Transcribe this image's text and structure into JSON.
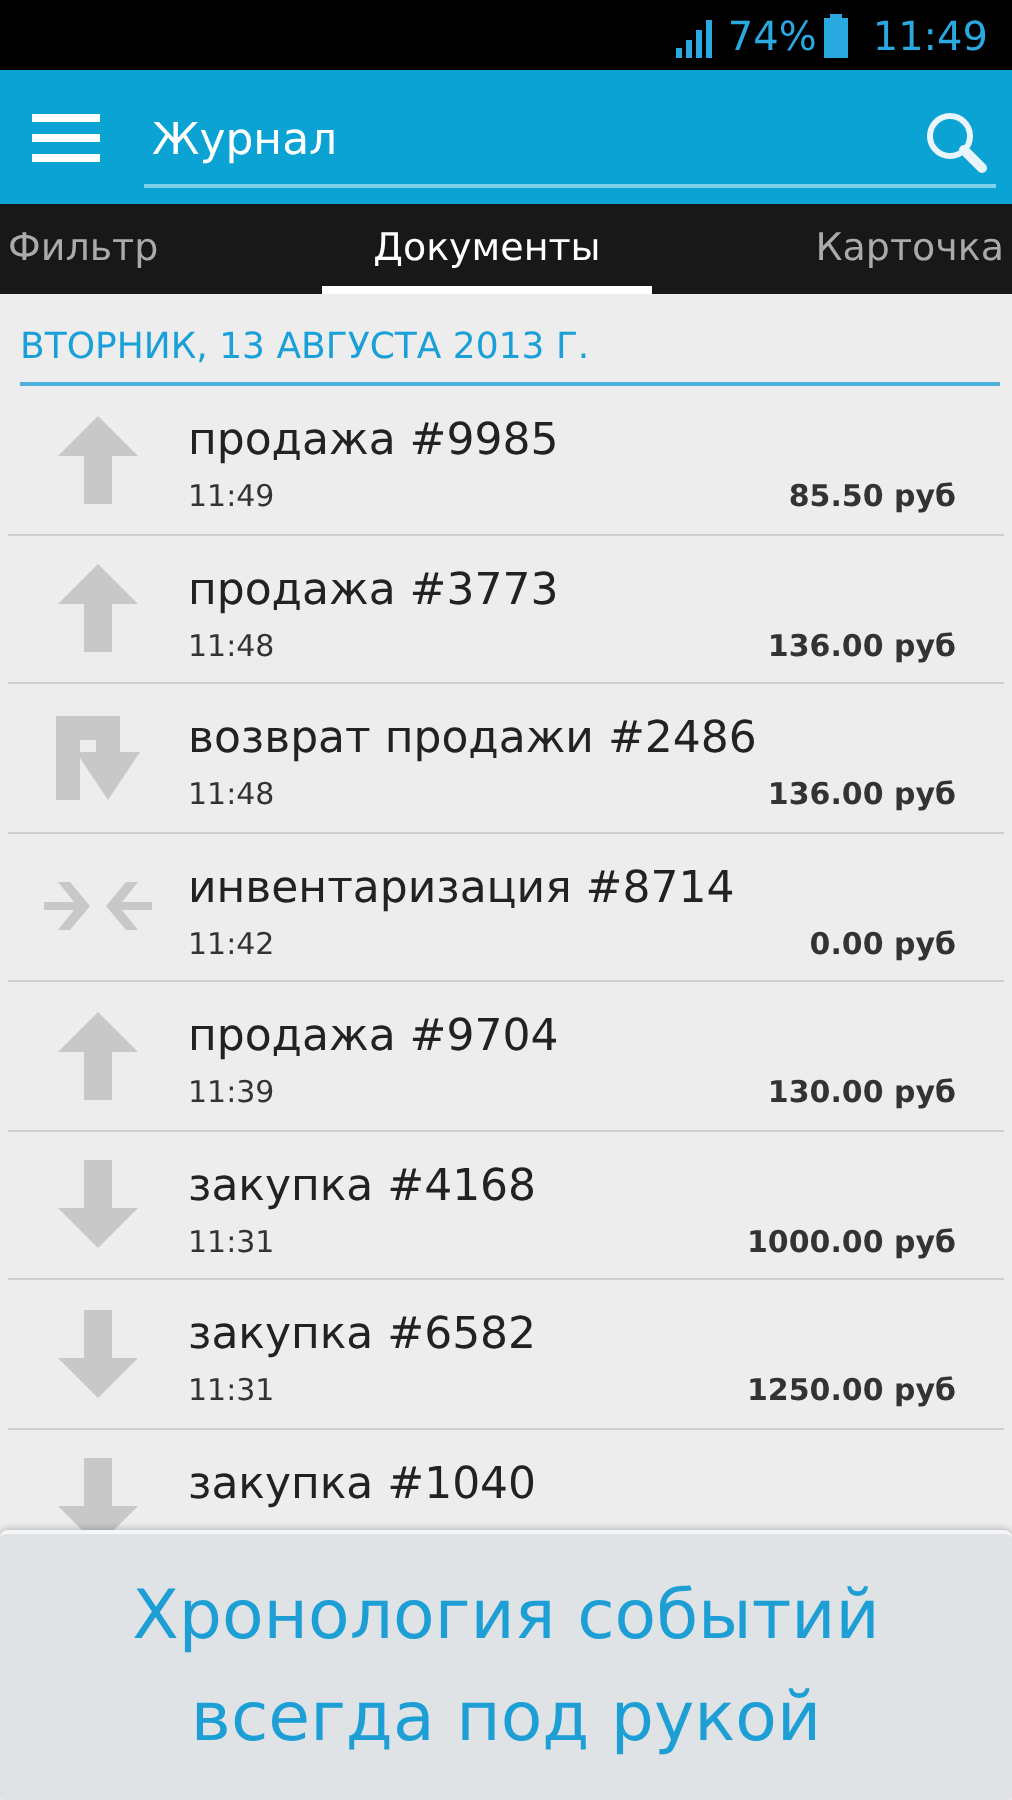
{
  "status_bar": {
    "battery_text": "74%",
    "time": "11:49"
  },
  "action_bar": {
    "title": "Журнал"
  },
  "tabs": [
    {
      "label": "Фильтр",
      "selected": false
    },
    {
      "label": "Документы",
      "selected": true
    },
    {
      "label": "Карточка",
      "selected": false
    }
  ],
  "section": {
    "title": "ВТОРНИК, 13 АВГУСТА 2013 Г."
  },
  "entries": [
    {
      "kind": "up",
      "title": "продажа #9985",
      "time": "11:49",
      "amount": "85.50 руб"
    },
    {
      "kind": "up",
      "title": "продажа #3773",
      "time": "11:48",
      "amount": "136.00 руб"
    },
    {
      "kind": "return",
      "title": "возврат продажи #2486",
      "time": "11:48",
      "amount": "136.00 руб"
    },
    {
      "kind": "inventory",
      "title": "инвентаризация #8714",
      "time": "11:42",
      "amount": "0.00 руб"
    },
    {
      "kind": "up",
      "title": "продажа #9704",
      "time": "11:39",
      "amount": "130.00 руб"
    },
    {
      "kind": "down",
      "title": "закупка #4168",
      "time": "11:31",
      "amount": "1000.00 руб"
    },
    {
      "kind": "down",
      "title": "закупка #6582",
      "time": "11:31",
      "amount": "1250.00 руб"
    },
    {
      "kind": "down",
      "title": "закупка #1040"
    }
  ],
  "banner": {
    "lines": [
      "Хронология событий",
      "всегда под рукой"
    ]
  }
}
